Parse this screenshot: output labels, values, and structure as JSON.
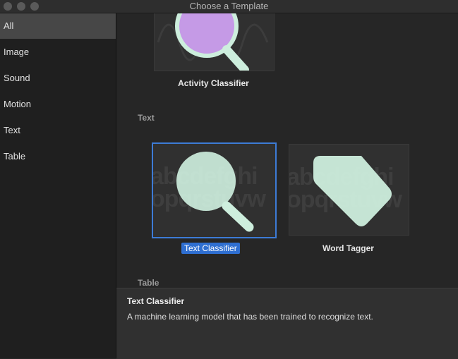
{
  "window": {
    "title": "Choose a Template"
  },
  "sidebar": {
    "items": [
      {
        "label": "All",
        "selected": true
      },
      {
        "label": "Image"
      },
      {
        "label": "Sound"
      },
      {
        "label": "Motion"
      },
      {
        "label": "Text"
      },
      {
        "label": "Table"
      }
    ]
  },
  "sections": {
    "activity": {
      "label": "Activity Classifier",
      "icon": "magnifier-waveform-icon",
      "accent": "#c59ae6"
    },
    "text_header": "Text",
    "text_templates": [
      {
        "label": "Text Classifier",
        "icon": "magnifier-text-icon",
        "selected": true,
        "accent": "#cdeedd"
      },
      {
        "label": "Word Tagger",
        "icon": "tag-text-icon",
        "accent": "#cdeedd"
      }
    ],
    "table_header": "Table"
  },
  "details": {
    "title": "Text Classifier",
    "description": "A machine learning model that has been trained to recognize text."
  },
  "colors": {
    "selection": "#2f6fd1",
    "selection_border": "#3d7bd6"
  }
}
